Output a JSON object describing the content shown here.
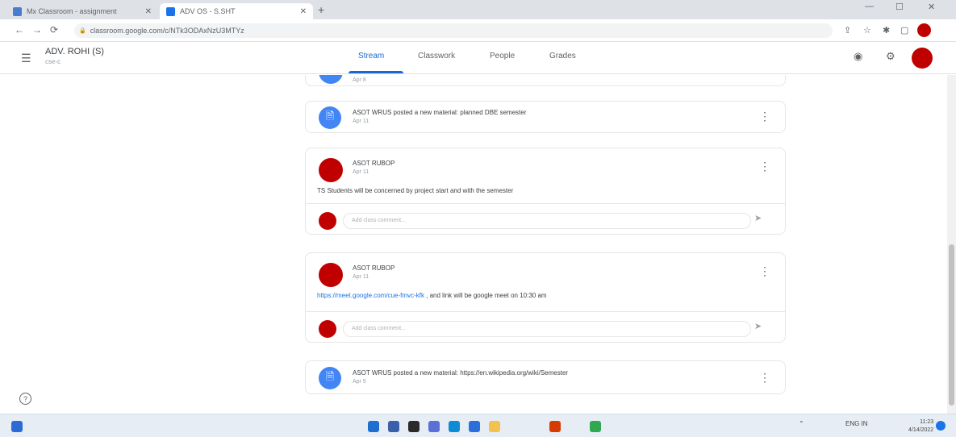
{
  "browser": {
    "tabs": [
      {
        "title": "Mx Classroom - assignment",
        "active": false,
        "favicon_color": "#4a7bd0"
      },
      {
        "title": "ADV OS - S.SHT",
        "active": true,
        "favicon_color": "#1a73e8"
      }
    ],
    "new_tab": "+",
    "window_controls": {
      "minimize": "—",
      "maximize": "☐",
      "close": "✕"
    },
    "nav": {
      "back": "←",
      "forward": "→",
      "reload": "⟳"
    },
    "url": "classroom.google.com/c/NTk3ODAxNzU3MTYz",
    "lock": "🔒"
  },
  "header": {
    "menu_icon": "☰",
    "class_title": "ADV. ROHI (S)",
    "class_subtitle": "cse-c",
    "tabs": [
      {
        "label": "Stream",
        "active": true
      },
      {
        "label": "Classwork",
        "active": false
      },
      {
        "label": "People",
        "active": false
      },
      {
        "label": "Grades",
        "active": false
      }
    ],
    "icons": {
      "meet": "◉",
      "settings": "⚙"
    }
  },
  "posts": [
    {
      "type": "material",
      "author_text": "",
      "date": "Apr 8"
    },
    {
      "type": "material",
      "author_text": "ASOT WRUS posted a new material: planned DBE semester",
      "date": "Apr 11"
    },
    {
      "type": "announcement",
      "author": "ASOT RUBOP",
      "date": "Apr 11",
      "body": "TS Students will be concerned by project start and with the semester",
      "comment_placeholder": "Add class comment..."
    },
    {
      "type": "announcement",
      "author": "ASOT RUBOP",
      "date": "Apr 11",
      "body_link": "https://meet.google.com/cue-fmvc-kfk",
      "body_rest": " , and link will be google meet on 10:30 am",
      "comment_placeholder": "Add class comment..."
    },
    {
      "type": "material",
      "author_text": "ASOT WRUS posted a new material: https://en.wikipedia.org/wiki/Semester",
      "date": "Apr 5"
    }
  ],
  "icons": {
    "material": "🗎",
    "more": "⋮",
    "send": "➤",
    "help": "?"
  },
  "taskbar": {
    "left_icon_color": "#2c6bd6",
    "apps": [
      {
        "name": "start",
        "color": "#1f6fd0"
      },
      {
        "name": "search",
        "color": "#3b5fa8"
      },
      {
        "name": "task-view",
        "color": "#2a2a2a"
      },
      {
        "name": "chat",
        "color": "#5b6fd6"
      },
      {
        "name": "edge",
        "color": "#0f8bd6"
      },
      {
        "name": "store",
        "color": "#2a6fdb"
      },
      {
        "name": "explorer",
        "color": "#f2c14e"
      },
      {
        "name": "office",
        "color": "#d83b01"
      },
      {
        "name": "chrome",
        "color": "#2fa84f"
      }
    ],
    "tray_text": "ENG IN",
    "time": "11:23",
    "date": "4/14/2022"
  },
  "colors": {
    "accent": "#1967d2",
    "avatar_red": "#c00000",
    "material_blue": "#4285f4"
  }
}
